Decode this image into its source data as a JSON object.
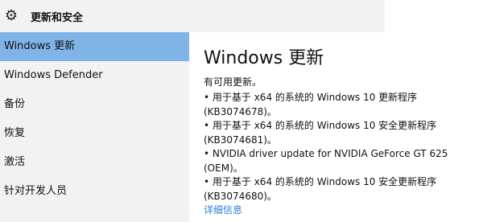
{
  "header": {
    "title": "更新和安全",
    "icon": "gear-icon"
  },
  "sidebar": {
    "items": [
      {
        "label": "Windows 更新"
      },
      {
        "label": "Windows Defender"
      },
      {
        "label": "备份"
      },
      {
        "label": "恢复"
      },
      {
        "label": "激活"
      },
      {
        "label": "针对开发人员"
      }
    ]
  },
  "main": {
    "title": "Windows 更新",
    "status": "有可用更新。",
    "updates": [
      {
        "line1": "• 用于基于 x64 的系统的 Windows 10 更新程序",
        "line2": "(KB3074678)。"
      },
      {
        "line1": "• 用于基于 x64 的系统的 Windows 10 安全更新程序",
        "line2": "(KB3074681)。"
      },
      {
        "line1": "• NVIDIA driver update for NVIDIA GeForce GT 625",
        "line2": "(OEM)。"
      },
      {
        "line1": "• 用于基于 x64 的系统的 Windows 10 安全更新程序",
        "line2": "(KB3074680)。"
      }
    ],
    "details_link": "详细信息"
  },
  "colors": {
    "selected": "#7fb4e8",
    "link": "#2a7bd6",
    "sidebar_bg": "#f2f2f2"
  }
}
